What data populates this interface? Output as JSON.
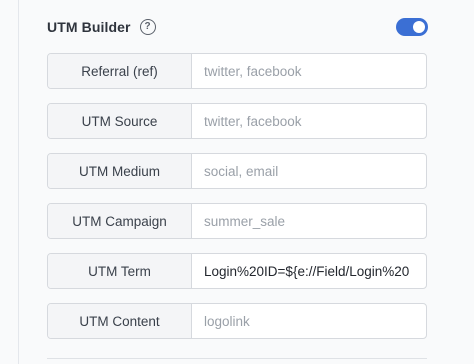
{
  "utm_builder": {
    "title": "UTM Builder",
    "help_icon": "help-circle-icon",
    "toggle_on": true,
    "accent_color": "#3b6fd4",
    "fields": [
      {
        "label": "Referral (ref)",
        "value": "",
        "placeholder": "twitter, facebook"
      },
      {
        "label": "UTM Source",
        "value": "",
        "placeholder": "twitter, facebook"
      },
      {
        "label": "UTM Medium",
        "value": "",
        "placeholder": "social, email"
      },
      {
        "label": "UTM Campaign",
        "value": "",
        "placeholder": "summer_sale"
      },
      {
        "label": "UTM Term",
        "value": "Login%20ID=${e://Field/Login%20",
        "placeholder": ""
      },
      {
        "label": "UTM Content",
        "value": "",
        "placeholder": "logolink"
      }
    ]
  }
}
